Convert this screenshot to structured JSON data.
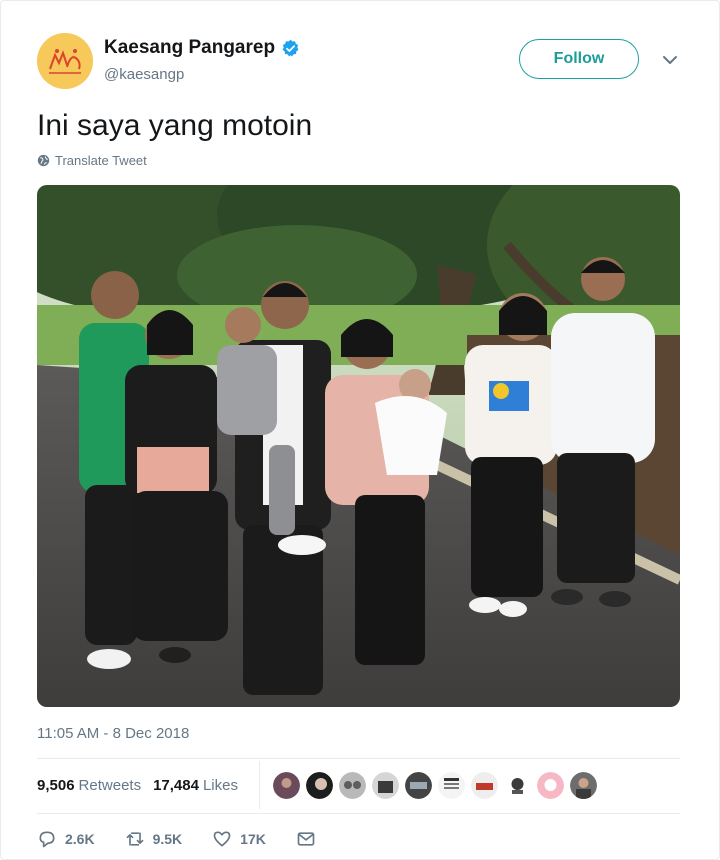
{
  "user": {
    "display_name": "Kaesang Pangarep",
    "handle": "@kaesangp"
  },
  "follow_label": "Follow",
  "tweet": {
    "text": "Ini saya yang motoin",
    "translate_label": "Translate Tweet",
    "timestamp": "11:05 AM - 8 Dec 2018"
  },
  "stats": {
    "retweets_count": "9,506",
    "retweets_label": "Retweets",
    "likes_count": "17,484",
    "likes_label": "Likes",
    "liker_avatars": 10
  },
  "actions": {
    "replies": "2.6K",
    "retweets": "9.5K",
    "likes": "17K"
  },
  "colors": {
    "accent": "#1da1f2",
    "follow_border": "#1da1a0",
    "muted": "#657786",
    "avatar_bg": "#f6c95a"
  },
  "icons": [
    "verified-icon",
    "chevron-down-icon",
    "globe-icon",
    "reply-icon",
    "retweet-icon",
    "like-icon",
    "message-icon"
  ]
}
